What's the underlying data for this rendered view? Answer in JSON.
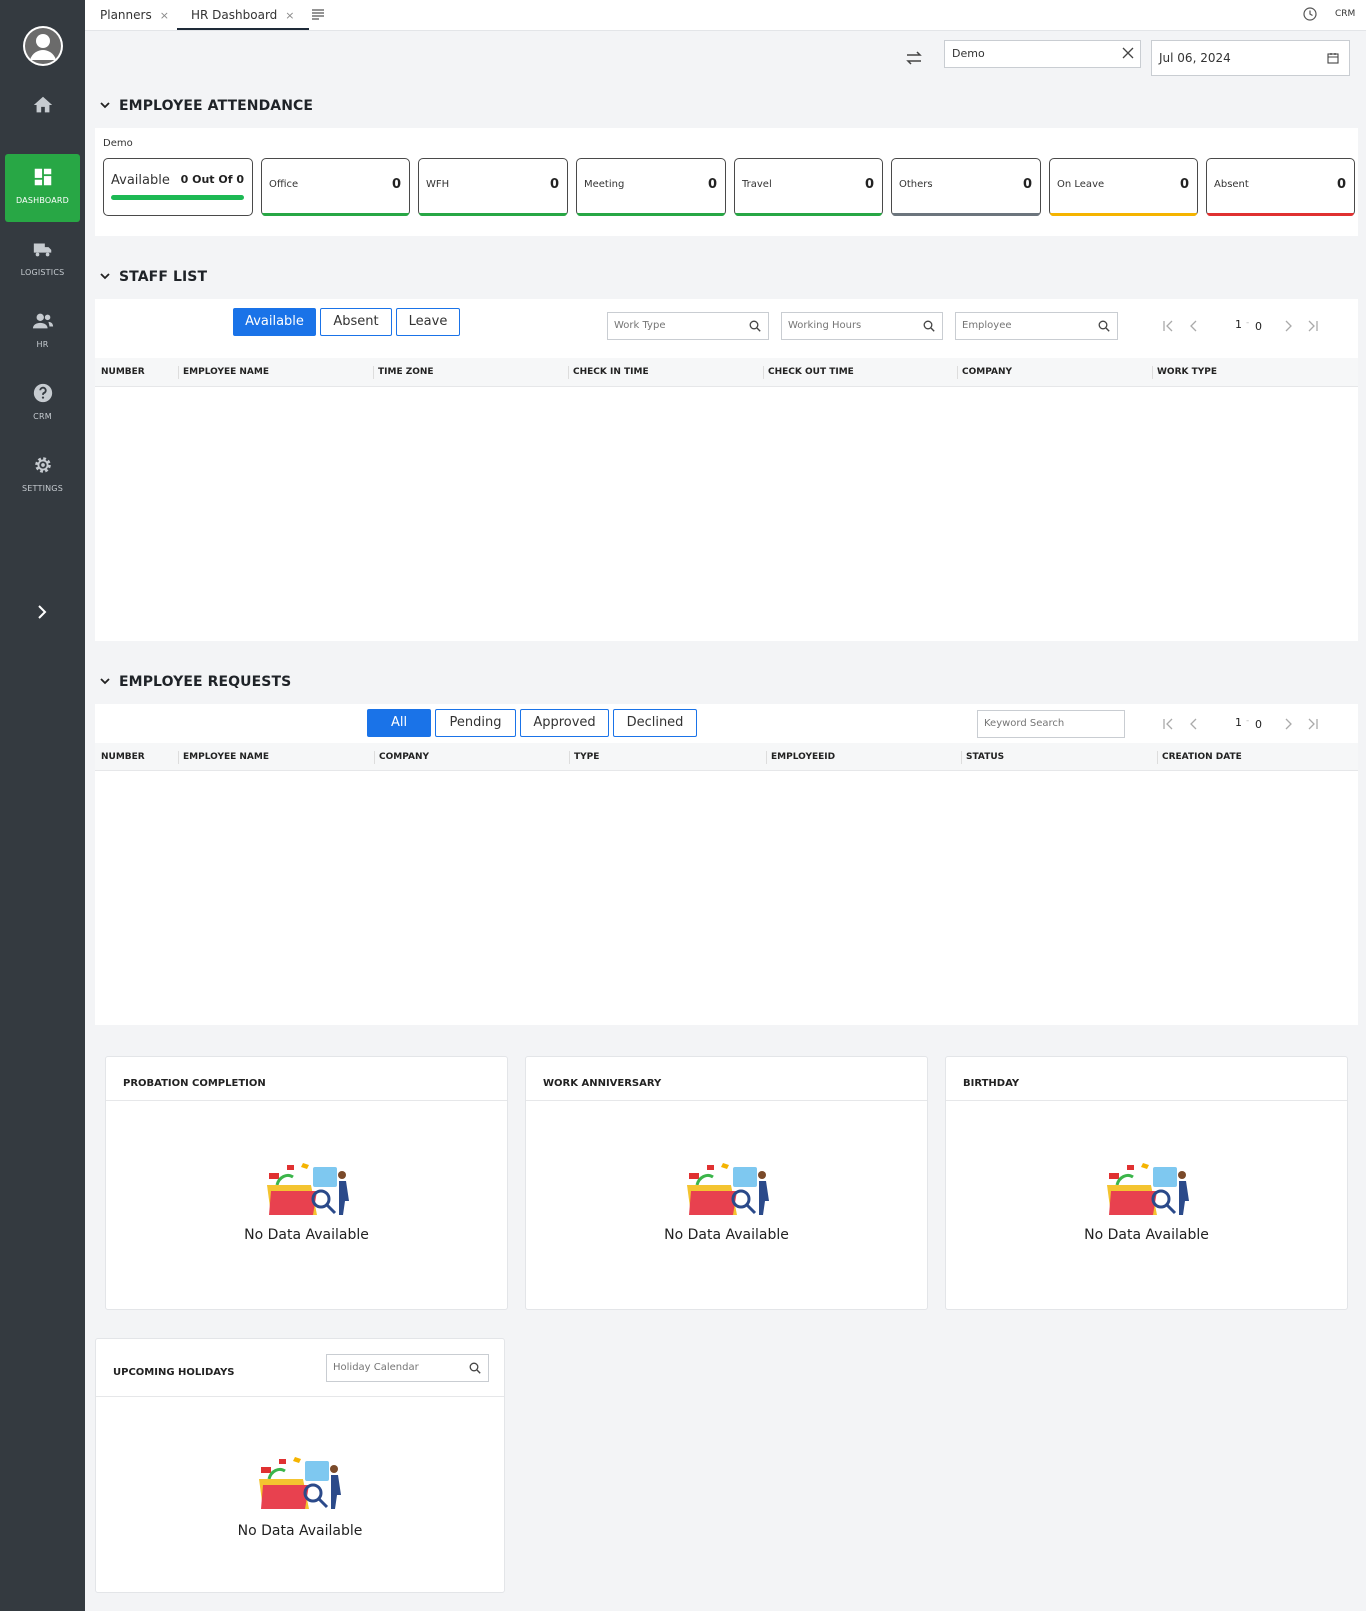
{
  "sidebar": {
    "items": [
      {
        "label": ""
      },
      {
        "label": "DASHBOARD"
      },
      {
        "label": "LOGISTICS"
      },
      {
        "label": "HR"
      },
      {
        "label": "CRM"
      },
      {
        "label": "SETTINGS"
      }
    ],
    "accent": "#28a745"
  },
  "tabs": [
    {
      "label": "Planners",
      "close": "×"
    },
    {
      "label": "HR Dashboard",
      "close": "×"
    }
  ],
  "topbar": {
    "right_label": "CRM"
  },
  "filters": {
    "company": "Demo",
    "date": "Jul 06, 2024"
  },
  "attendance": {
    "title": "EMPLOYEE ATTENDANCE",
    "company": "Demo",
    "available": {
      "label": "Available",
      "value": "0 Out Of 0"
    },
    "cards": [
      {
        "label": "Office",
        "value": "0",
        "color": "#28a745"
      },
      {
        "label": "WFH",
        "value": "0",
        "color": "#28a745"
      },
      {
        "label": "Meeting",
        "value": "0",
        "color": "#28a745"
      },
      {
        "label": "Travel",
        "value": "0",
        "color": "#28a745"
      },
      {
        "label": "Others",
        "value": "0",
        "color": "#6c757d"
      },
      {
        "label": "On Leave",
        "value": "0",
        "color": "#f5b400"
      },
      {
        "label": "Absent",
        "value": "0",
        "color": "#e03131"
      }
    ]
  },
  "staff": {
    "title": "STAFF LIST",
    "filters": [
      "Available",
      "Absent",
      "Leave"
    ],
    "active_filter": "Available",
    "search": {
      "work_type": "Work Type",
      "working_hours": "Working Hours",
      "employee": "Employee"
    },
    "pager": {
      "page": "1",
      "sep": "-",
      "total": "0"
    },
    "columns": [
      "NUMBER",
      "EMPLOYEE NAME",
      "TIME ZONE",
      "CHECK IN TIME",
      "CHECK OUT TIME",
      "COMPANY",
      "WORK TYPE"
    ],
    "rows": []
  },
  "requests": {
    "title": "EMPLOYEE REQUESTS",
    "filters": [
      "All",
      "Pending",
      "Approved",
      "Declined"
    ],
    "active_filter": "All",
    "search": {
      "keyword": "Keyword Search"
    },
    "pager": {
      "page": "1",
      "sep": "-",
      "total": "0"
    },
    "columns": [
      "NUMBER",
      "EMPLOYEE NAME",
      "COMPANY",
      "TYPE",
      "EMPLOYEEID",
      "STATUS",
      "CREATION DATE"
    ],
    "rows": []
  },
  "widgets": {
    "probation": {
      "title": "PROBATION COMPLETION",
      "empty": "No Data Available"
    },
    "anniversary": {
      "title": "WORK ANNIVERSARY",
      "empty": "No Data Available"
    },
    "birthday": {
      "title": "BIRTHDAY",
      "empty": "No Data Available"
    },
    "holidays": {
      "title": "UPCOMING HOLIDAYS",
      "search_placeholder": "Holiday Calendar",
      "empty": "No Data Available"
    }
  }
}
